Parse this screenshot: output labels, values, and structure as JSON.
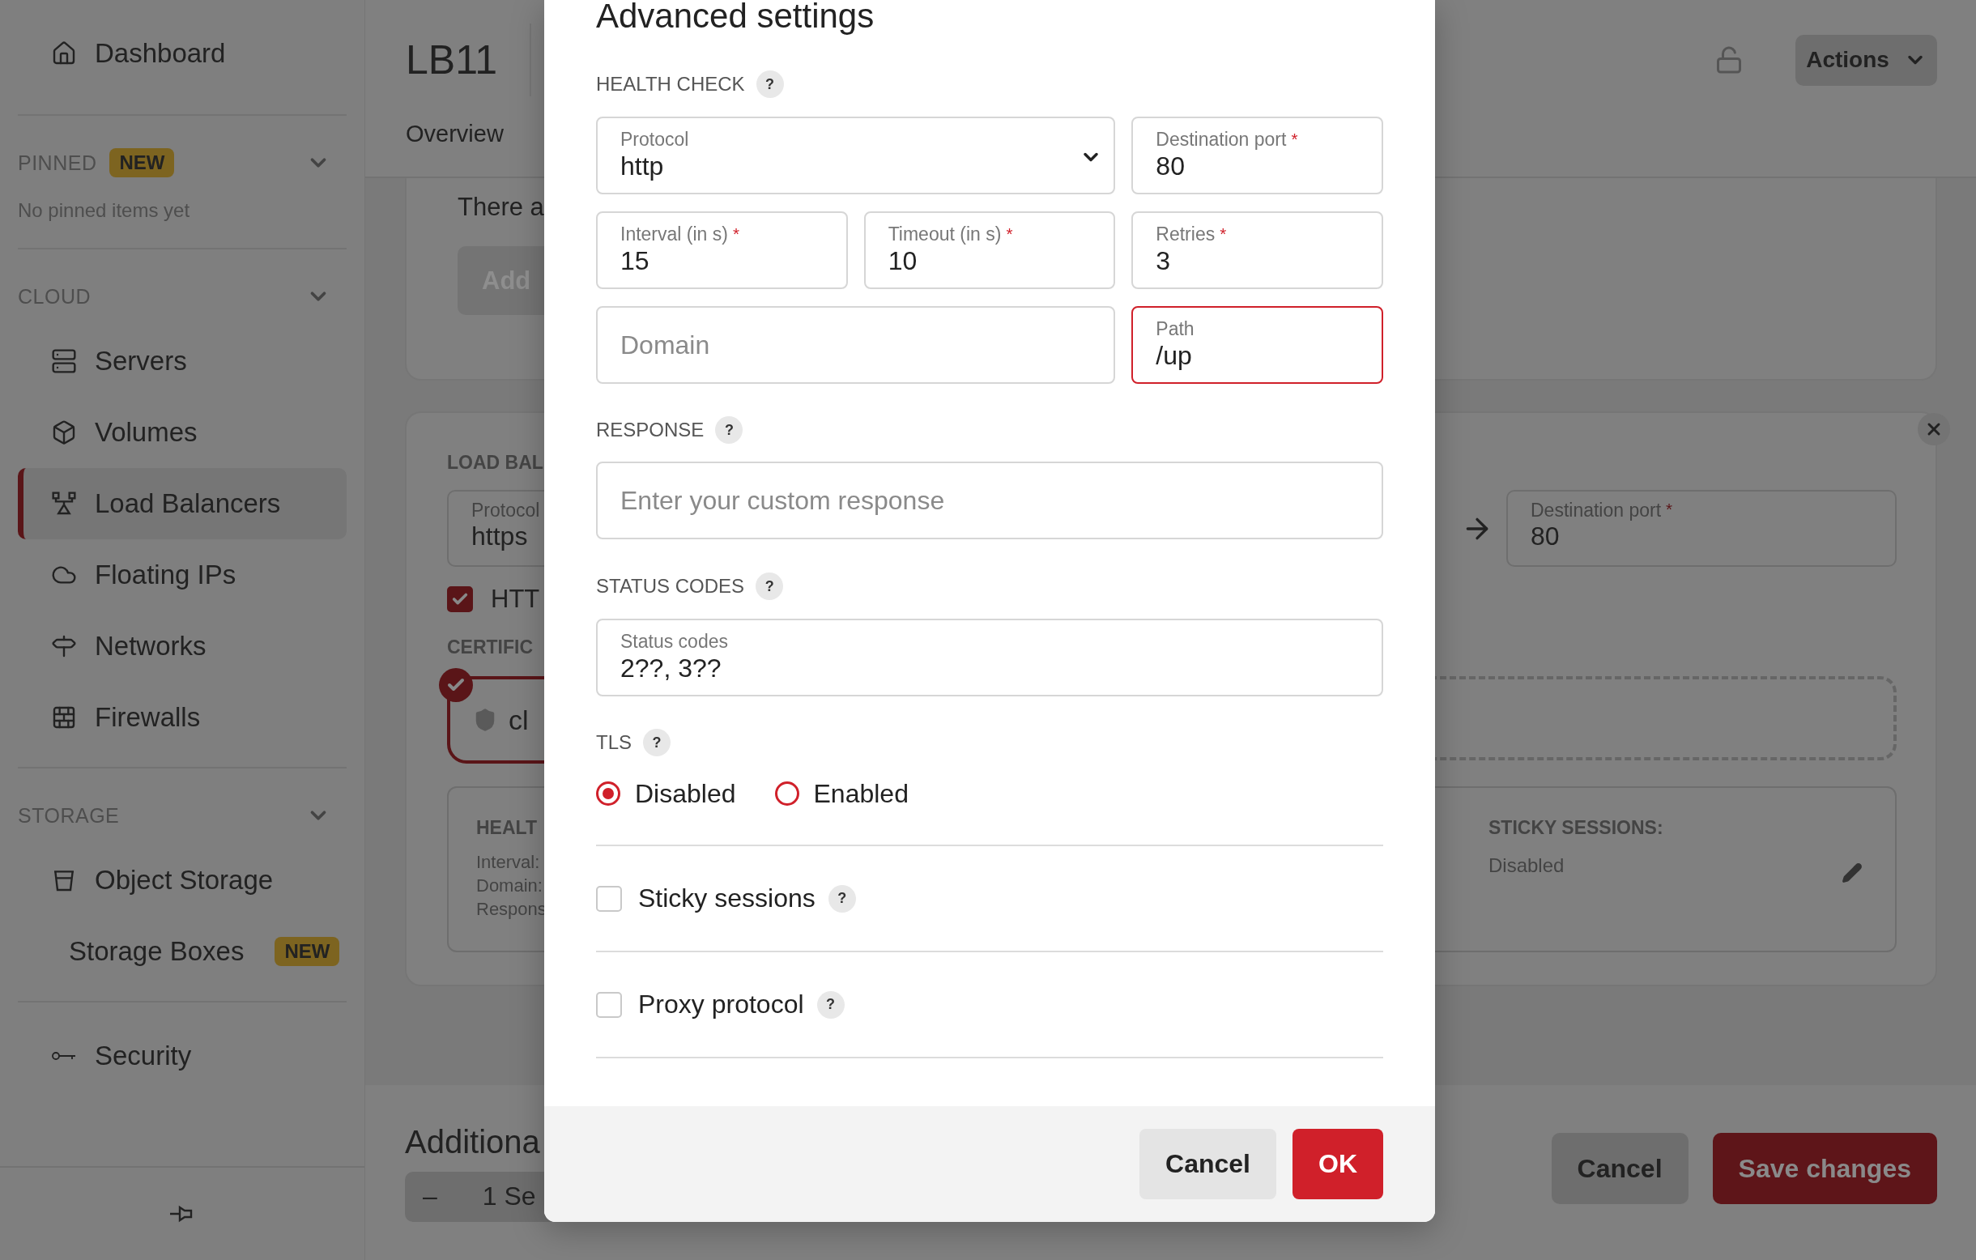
{
  "sidebar": {
    "top": [
      {
        "label": "Dashboard",
        "selected": false
      }
    ],
    "sections": [
      {
        "title": "PINNED",
        "badge": "NEW",
        "expanded": true,
        "empty_text": "No pinned items yet"
      },
      {
        "title": "CLOUD",
        "expanded": true,
        "items": [
          {
            "label": "Servers",
            "selected": false
          },
          {
            "label": "Volumes",
            "selected": false
          },
          {
            "label": "Load Balancers",
            "selected": true
          },
          {
            "label": "Floating IPs",
            "selected": false
          },
          {
            "label": "Networks",
            "selected": false
          },
          {
            "label": "Firewalls",
            "selected": false
          }
        ]
      },
      {
        "title": "STORAGE",
        "expanded": true,
        "items": [
          {
            "label": "Object Storage",
            "selected": false
          },
          {
            "label": "Storage Boxes",
            "selected": false,
            "badge": "NEW"
          }
        ]
      }
    ],
    "bottom": [
      {
        "label": "Security",
        "selected": false
      }
    ]
  },
  "header": {
    "title": "LB11",
    "tabs": [
      {
        "label": "Overview",
        "selected": false
      }
    ],
    "actions": "Actions"
  },
  "services_card": {
    "text": "There a",
    "button": "Add"
  },
  "load_balancer_card": {
    "section": "LOAD BAL",
    "protocol": {
      "label": "Protocol",
      "value": "https"
    },
    "destination": {
      "label": "Destination port",
      "required_mark": "*",
      "value": "80"
    },
    "http_redirect": {
      "label": "HTT",
      "checked": true
    },
    "certificates_label": "CERTIFIC",
    "certificate": {
      "name": "cl",
      "selected": true
    },
    "health": {
      "title": "HEALT",
      "lines": [
        "Interval:",
        "Domain:",
        "Respons"
      ]
    },
    "sticky": {
      "title": "STICKY SESSIONS:",
      "value": "Disabled"
    }
  },
  "footer": {
    "title": "Additiona",
    "stepper": {
      "minus": "–",
      "value": "1 Se"
    },
    "cancel": "Cancel",
    "save": "Save changes"
  },
  "dialog": {
    "title": "Advanced settings",
    "health_check": {
      "label": "HEALTH CHECK",
      "help": "?",
      "fields": [
        {
          "kind": "select",
          "label": "Protocol",
          "value": "http",
          "wide": true,
          "invalid": false
        },
        {
          "kind": "input",
          "label": "Destination port",
          "required_mark": "*",
          "value": "80",
          "wide": false,
          "invalid": false
        },
        {
          "kind": "input",
          "label": "Interval (in s)",
          "required_mark": "*",
          "value": "15",
          "wide": false,
          "invalid": false
        },
        {
          "kind": "input",
          "label": "Timeout (in s)",
          "required_mark": "*",
          "value": "10",
          "wide": false,
          "invalid": false
        },
        {
          "kind": "input",
          "label": "Retries",
          "required_mark": "*",
          "value": "3",
          "wide": false,
          "invalid": false
        },
        {
          "kind": "input",
          "placeholder": "Domain",
          "wide": true,
          "invalid": false
        },
        {
          "kind": "input",
          "label": "Path",
          "value": "/up",
          "wide": false,
          "invalid": true
        }
      ]
    },
    "response": {
      "label": "RESPONSE",
      "help": "?",
      "placeholder": "Enter your custom response"
    },
    "status_codes": {
      "label": "STATUS CODES",
      "help": "?",
      "field": {
        "label": "Status codes",
        "value": "2??, 3??"
      }
    },
    "tls": {
      "label": "TLS",
      "help": "?",
      "options": [
        {
          "label": "Disabled",
          "selected": true
        },
        {
          "label": "Enabled",
          "selected": false
        }
      ]
    },
    "toggles": [
      {
        "label": "Sticky sessions",
        "help": "?",
        "checked": false
      },
      {
        "label": "Proxy protocol",
        "help": "?",
        "checked": false
      }
    ],
    "cancel": "Cancel",
    "ok": "OK"
  }
}
